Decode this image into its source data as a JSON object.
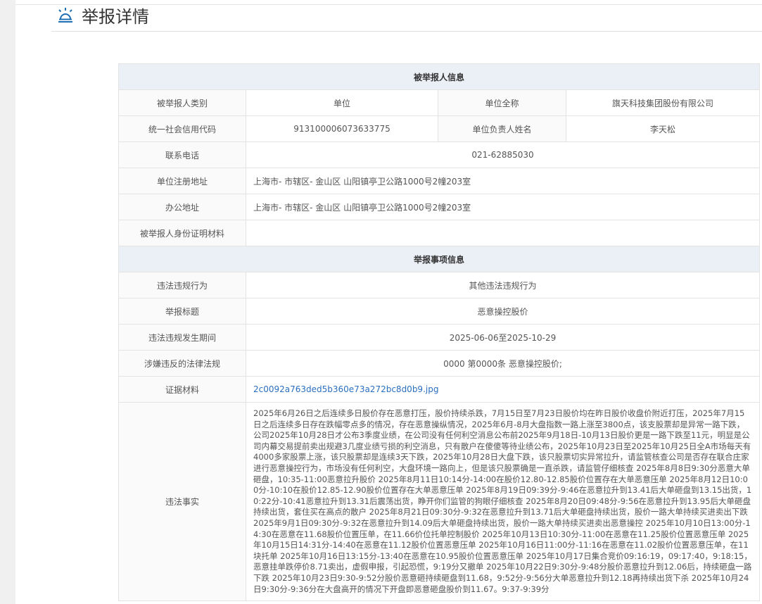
{
  "page": {
    "title": "举报详情",
    "icon": "alarm-bell-icon",
    "accent": "#1f6fb5"
  },
  "reported_section": {
    "heading": "被举报人信息",
    "type_label": "被举报人类别",
    "type_value": "单位",
    "fullname_label": "单位全称",
    "fullname_value": "旗天科技集团股份有限公司",
    "credit_label": "统一社会信用代码",
    "credit_value": "913100006073633775",
    "leader_label": "单位负责人姓名",
    "leader_value": "李天松",
    "phone_label": "联系电话",
    "phone_value": "021-62885030",
    "reg_addr_label": "单位注册地址",
    "reg_addr_value": "上海市- 市辖区- 金山区 山阳镇亭卫公路1000号2幢203室",
    "office_addr_label": "办公地址",
    "office_addr_value": "上海市- 市辖区- 金山区 山阳镇亭卫公路1000号2幢203室",
    "id_material_label": "被举报人身份证明材料",
    "id_material_value": ""
  },
  "matter_section": {
    "heading": "举报事项信息",
    "behavior_label": "违法违规行为",
    "behavior_value": "其他违法违规行为",
    "subject_label": "举报标题",
    "subject_value": "恶意操控股价",
    "period_label": "违法违规发生期间",
    "period_value": "2025-06-06至2025-10-29",
    "law_label": "涉嫌违反的法律法规",
    "law_value": "0000 第0000条 恶意操控股价;",
    "evidence_label": "证据材料",
    "evidence_value": "2c0092a763ded5b360e73a272bc8d0b9.jpg",
    "facts_label": "违法事实",
    "facts_value": "2025年6月26日之后连续多日股价存在恶意打压，股价持续杀跌，7月15日至7月23日股价均在昨日股价收盘价附近打压，2025年7月15日之后连续多日存在跌幅零点多的情况，存在恶意操纵情况，2025年6月-8月大盘指数一路上涨至3800点，该支股票却是异常一路下跌，公司2025年10月28日才公布3季度业绩，在公司没有任何利空消息公布前2025年9月18日-10月13日股价更是一路下跌至11元，明显是公司内幕交易提前卖出规避3几度业绩亏损的利空消息，只有散户在傻傻等待业绩公布，2025年10月23日至2025年10月25日全A市场每天有4000多家股票上涨，该只股票却是连续3天下跌，2025年10月28日大盘下跌，该只股票切实异常拉升，请监管核查公司是否存在联合庄家进行恶意操控行为，市场没有任何利空，大盘环境一路向上，但是该只股票确是一直杀跌，请监管仔细核查 2025年8月8日9:30分恶意大单砸盘，10:35-11:00恶意拉升股价 2025年8月11日10:14分-14:00在股价12.80-12.85股价位置存在大单恶意压单 2025年8月12日10:00分-10:10在股价12.85-12.90股价位置存在大单恶意压单 2025年8月19日09:39分-9:46在恶意拉升到13.41后大单砸盘到13.15出货，10:22分-10:41恶意拉升到13.31后震荡出货，睁开你们监管的狗眼仔细核查 2025年8月20日09:48分-9:56在恶意拉升到13.95后大单砸盘持续出货，套住买在高点的散户 2025年8月21日09:30分-9:32在恶意拉升到13.71后大单砸盘持续出货，股价一路大单持续买进卖出下跌 2025年9月1日09:30分-9:32在恶意拉升到14.09后大单砸盘持续出货，股价一路大单持续买进卖出恶意操控 2025年10月10日13:00分-14:30在恶意在11.68股价位置压单，在11.66价位托单控制股价 2025年10月13日10:30分-11:00在恶意在11.25股价位置恶意压单 2025年10月15日14:31分-14:40在恶意在11.12股价位置恶意压单 2025年10月16日11:00分-11:16在恶意在11.02股价位置恶意压单，在11块托单 2025年10月16日13:15分-13:40在恶意在10.95股价位置恶意压单 2025年10月17日集合竞价09:16:19，09:17:40，9:18:15，恶意挂单跌停价8.71卖出，虚假申报，引起恐慌，9:19分又撤单 2025年10月22日9:30分-9:48分股价恶意拉升到12.06后，持续砸盘一路下跌 2025年10月23日9:30-9:52分股价恶意砸持续砸盘到11.68，9:52分-9:56分大单恶意拉升到12.18再持续出货下杀 2025年10月24日9:30分-9:36分在大盘高开的情况下开盘即恶意砸盘股价到11.67。9:37-9:39分"
  }
}
